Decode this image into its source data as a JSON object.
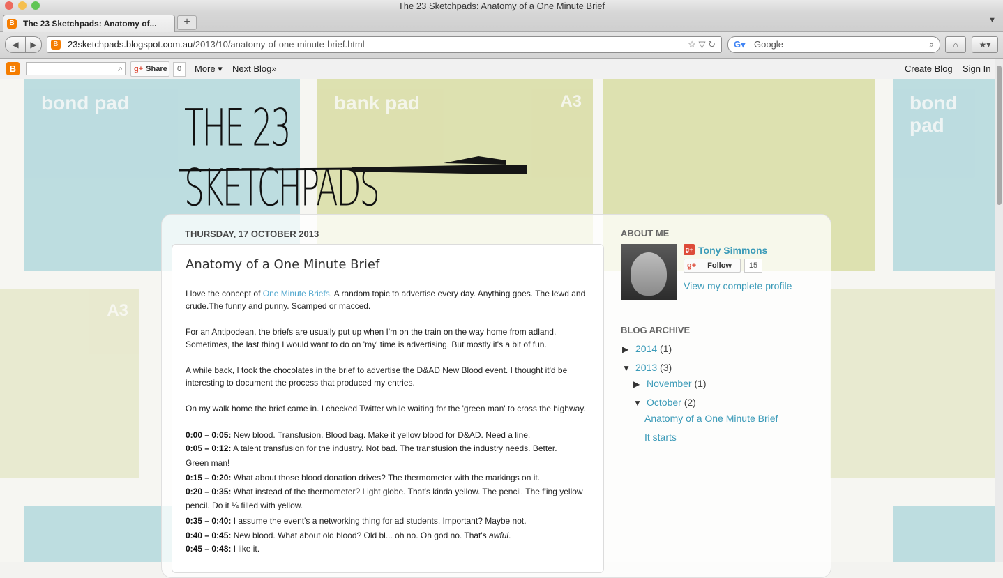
{
  "window": {
    "title": "The 23 Sketchpads: Anatomy of a One Minute Brief"
  },
  "tab": {
    "title": "The 23 Sketchpads: Anatomy of...",
    "close": "×",
    "new": "+"
  },
  "navbar": {
    "url_host": "23sketchpads.blogspot.com.au",
    "url_path": "/2013/10/anatomy-of-one-minute-brief.html",
    "search_placeholder": "Google"
  },
  "blogger_bar": {
    "share_label": "Share",
    "share_count": "0",
    "more_label": "More ▾",
    "next_blog_label": "Next Blog»",
    "create_blog_label": "Create Blog",
    "sign_in_label": "Sign In"
  },
  "blog": {
    "title": "THE 23 SKETCHPADS",
    "bg_pads": [
      "bond pad",
      "bank pad",
      "A3",
      "bond pad",
      "A3"
    ]
  },
  "post": {
    "date": "THURSDAY, 17 OCTOBER 2013",
    "title": "Anatomy of a One Minute Brief",
    "p1_before": "I love the concept of ",
    "p1_link": "One Minute Briefs",
    "p1_after": ". A random topic to advertise every day. Anything goes. The lewd and crude.The funny and punny. Scamped or macced.",
    "p2": "For an Antipodean, the briefs are usually put up when I'm on the train on the way home from adland. Sometimes, the last thing I would want to do on 'my' time is advertising. But mostly it's a bit of fun.",
    "p3": "A while back, I took the chocolates in the brief to advertise the D&AD New Blood event. I thought it'd be interesting to document the process that produced my entries.",
    "p4": "On my walk home the brief came in. I checked Twitter while waiting for the 'green man' to cross the highway.",
    "timeline": [
      {
        "time": "0:00 – 0:05:",
        "text": " New blood. Transfusion. Blood bag. Make it yellow blood for D&AD. Need a line."
      },
      {
        "time": "0:05 – 0:12:",
        "text": " A talent transfusion for the industry. Not bad. The transfusion the industry needs. Better."
      },
      {
        "time": "",
        "text": "Green man!"
      },
      {
        "time": "0:15 – 0:20:",
        "text": " What about those blood donation drives? The thermometer with the markings on it."
      },
      {
        "time": "0:20 – 0:35:",
        "text": " What instead of the thermometer? Light globe. That's kinda yellow. The pencil. The f'ing yellow pencil. Do it ¼ filled with yellow."
      },
      {
        "time": "0:35 – 0:40:",
        "text": " I assume the event's a networking thing for ad students. Important? Maybe not."
      },
      {
        "time": "0:40 – 0:45:",
        "text": " New blood. What about old blood? Old bl... oh no. Oh god no. That's ",
        "em": "awful",
        "tail": "."
      },
      {
        "time": "0:45 – 0:48:",
        "text": " I like it."
      }
    ]
  },
  "sidebar": {
    "about_heading": "ABOUT ME",
    "profile_name": "Tony Simmons",
    "follow_label": "Follow",
    "follow_count": "15",
    "view_profile": "View my complete profile",
    "archive_heading": "BLOG ARCHIVE",
    "archive": {
      "y2014": {
        "label": "2014",
        "count": "(1)"
      },
      "y2013": {
        "label": "2013",
        "count": "(3)"
      },
      "nov": {
        "label": "November",
        "count": "(1)"
      },
      "oct": {
        "label": "October",
        "count": "(2)"
      },
      "posts": [
        "Anatomy of a One Minute Brief",
        "It starts"
      ]
    }
  },
  "colors": {
    "link": "#4fa6cd",
    "accent": "#f57d00",
    "gplus": "#dd4b39"
  },
  "icons": [
    "blogger-icon",
    "search-icon",
    "google-plus-icon",
    "star-icon",
    "reload-icon",
    "home-icon",
    "bookmark-icon"
  ]
}
